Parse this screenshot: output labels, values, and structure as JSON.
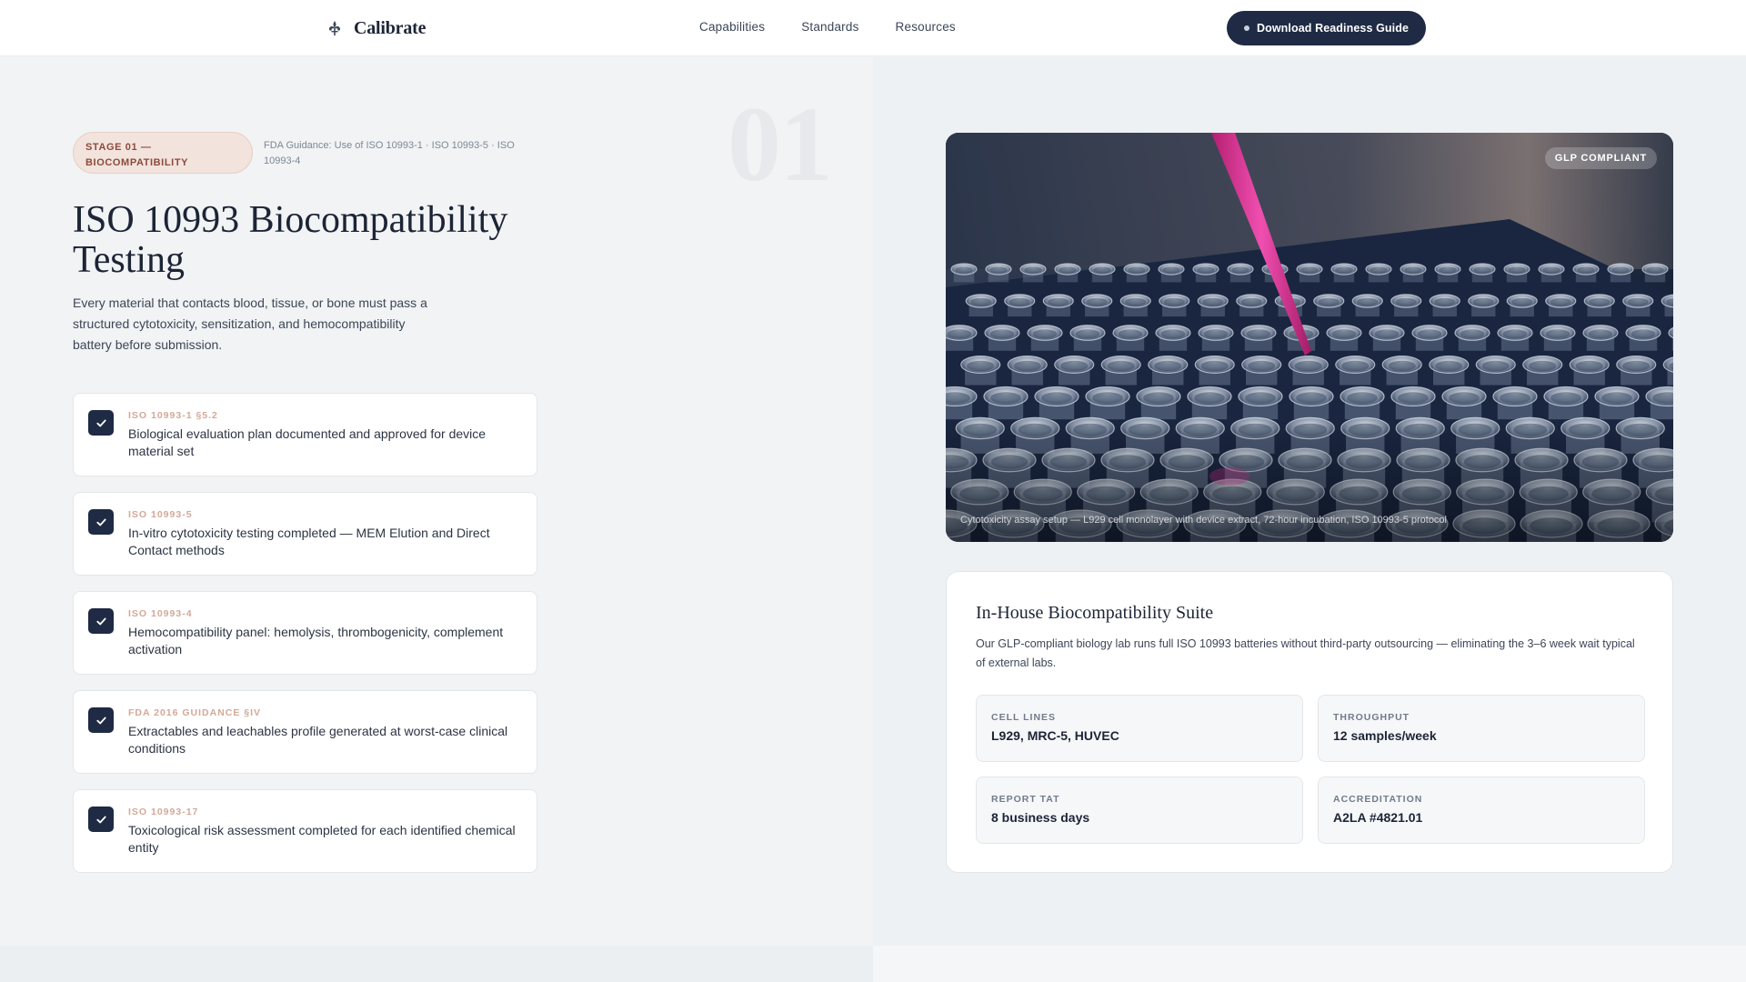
{
  "brand": {
    "name": "Calibrate",
    "logo_icon": "fleur-de-lis-icon"
  },
  "nav": {
    "links": [
      "Capabilities",
      "Standards",
      "Resources"
    ],
    "cta_label": "Download Readiness Guide"
  },
  "stage": {
    "number": "01",
    "pill_line1": "STAGE 01 —",
    "pill_line2": "BIOCOMPATIBILITY",
    "reference": "FDA Guidance: Use of ISO 10993-1 · ISO 10993-5 · ISO 10993-4"
  },
  "main": {
    "title": "ISO 10993 Biocompatibility Testing",
    "description": "Every material that contacts blood, tissue, or bone must pass a structured cytotoxicity, sensitization, and hemocompatibility battery before submission."
  },
  "checklist": [
    {
      "code": "ISO 10993-1 §5.2",
      "text": "Biological evaluation plan documented and approved for device material set",
      "checked": true
    },
    {
      "code": "ISO 10993-5",
      "text": "In-vitro cytotoxicity testing completed — MEM Elution and Direct Contact methods",
      "checked": true
    },
    {
      "code": "ISO 10993-4",
      "text": "Hemocompatibility panel: hemolysis, thrombogenicity, complement activation",
      "checked": true
    },
    {
      "code": "FDA 2016 GUIDANCE §IV",
      "text": "Extractables and leachables profile generated at worst-case clinical conditions",
      "checked": true
    },
    {
      "code": "ISO 10993-17",
      "text": "Toxicological risk assessment completed for each identified chemical entity",
      "checked": true
    }
  ],
  "hero": {
    "badge": "GLP COMPLIANT",
    "caption": "Cytotoxicity assay setup — L929 cell monolayer with device extract, 72-hour incubation, ISO 10993-5 protocol"
  },
  "suite": {
    "title": "In-House Biocompatibility Suite",
    "description": "Our GLP-compliant biology lab runs full ISO 10993 batteries without third-party outsourcing — eliminating the 3–6 week wait typical of external labs.",
    "stats": [
      {
        "label": "CELL LINES",
        "value": "L929, MRC-5, HUVEC"
      },
      {
        "label": "THROUGHPUT",
        "value": "12 samples/week"
      },
      {
        "label": "REPORT TAT",
        "value": "8 business days"
      },
      {
        "label": "ACCREDITATION",
        "value": "A2LA #4821.01"
      }
    ]
  },
  "colors": {
    "navy": "#1f2a44",
    "pill_bg": "#f3e3dd",
    "pill_text": "#8a4b3c",
    "code_accent": "#d4a898",
    "pipette_magenta": "#d9358f"
  }
}
